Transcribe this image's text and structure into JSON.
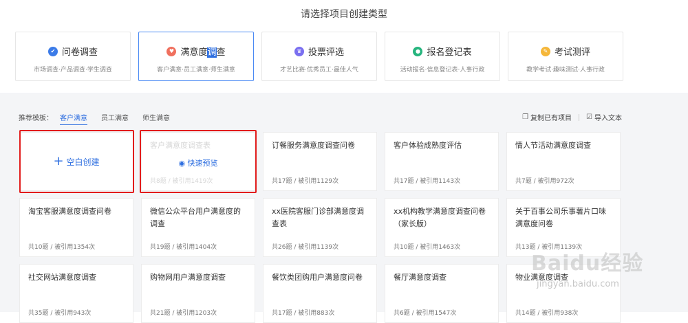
{
  "header": {
    "title": "请选择项目创建类型"
  },
  "types": [
    {
      "name": "问卷调查",
      "desc": "市场调查·产品调查·学生调查",
      "icon": "check-circle-icon",
      "color": "#3b7be8",
      "glyph": "✔",
      "active": false,
      "name_pre": "问卷调查",
      "name_sel": "",
      "name_post": ""
    },
    {
      "name": "满意度调查",
      "desc": "客户满意·员工满意·师生满意",
      "icon": "heart-circle-icon",
      "color": "#f0705e",
      "glyph": "♥",
      "active": true,
      "name_pre": "满意度",
      "name_sel": "调",
      "name_post": "查"
    },
    {
      "name": "投票评选",
      "desc": "才艺比赛·优秀员工·最佳人气",
      "icon": "trophy-circle-icon",
      "color": "#7a6ff0",
      "glyph": "♛",
      "active": false,
      "name_pre": "投票评选",
      "name_sel": "",
      "name_post": ""
    },
    {
      "name": "报名登记表",
      "desc": "活动报名·信息登记表·人事行政",
      "icon": "user-circle-icon",
      "color": "#27b57e",
      "glyph": "●",
      "active": false,
      "name_pre": "报名登记表",
      "name_sel": "",
      "name_post": ""
    },
    {
      "name": "考试测评",
      "desc": "教学考试·趣味测试·人事行政",
      "icon": "pencil-circle-icon",
      "color": "#f5b73a",
      "glyph": "✎",
      "active": false,
      "name_pre": "考试测评",
      "name_sel": "",
      "name_post": ""
    }
  ],
  "templates_bar": {
    "label": "推荐模板：",
    "tabs": [
      "客户满意",
      "员工满意",
      "师生满意"
    ],
    "active_tab": 0,
    "copy_label": "复制已有项目",
    "import_label": "导入文本"
  },
  "blank_card": {
    "label": "空白创建"
  },
  "preview_label": "快速预览",
  "cards": [
    {
      "title": "客户满意度调查表",
      "meta": "共8题 / 被引用1419次",
      "faded": true
    },
    {
      "title": "订餐服务满意度调查问卷",
      "meta": "共17题 / 被引用1129次"
    },
    {
      "title": "客户体验成熟度评估",
      "meta": "共17题 / 被引用1143次"
    },
    {
      "title": "情人节活动满意度调查",
      "meta": "共7题 / 被引用972次"
    },
    {
      "title": "淘宝客服满意度调查问卷",
      "meta": "共10题 / 被引用1354次"
    },
    {
      "title": "微信公众平台用户满意度的调查",
      "meta": "共19题 / 被引用1404次"
    },
    {
      "title": "xx医院客服门诊部满意度调查表",
      "meta": "共26题 / 被引用1139次"
    },
    {
      "title": "xx机构教学满意度调查问卷（家长版）",
      "meta": "共10题 / 被引用1463次"
    },
    {
      "title": "关于百事公司乐事薯片口味满意度问卷",
      "meta": "共13题 / 被引用1139次"
    },
    {
      "title": "社交网站满意度调查",
      "meta": "共35题 / 被引用943次"
    },
    {
      "title": "购物网用户满意度调查",
      "meta": "共21题 / 被引用1203次"
    },
    {
      "title": "餐饮类团购用户满意度问卷",
      "meta": "共17题 / 被引用883次"
    },
    {
      "title": "餐厅满意度调查",
      "meta": "共6题 / 被引用1547次"
    },
    {
      "title": "物业满意度调查",
      "meta": "共14题 / 被引用938次"
    }
  ],
  "watermark": {
    "text": "Baidu经验",
    "url": "jingyan.baidu.com"
  },
  "colors": {
    "accent": "#2f6fe0",
    "highlight": "#e21c1c"
  }
}
